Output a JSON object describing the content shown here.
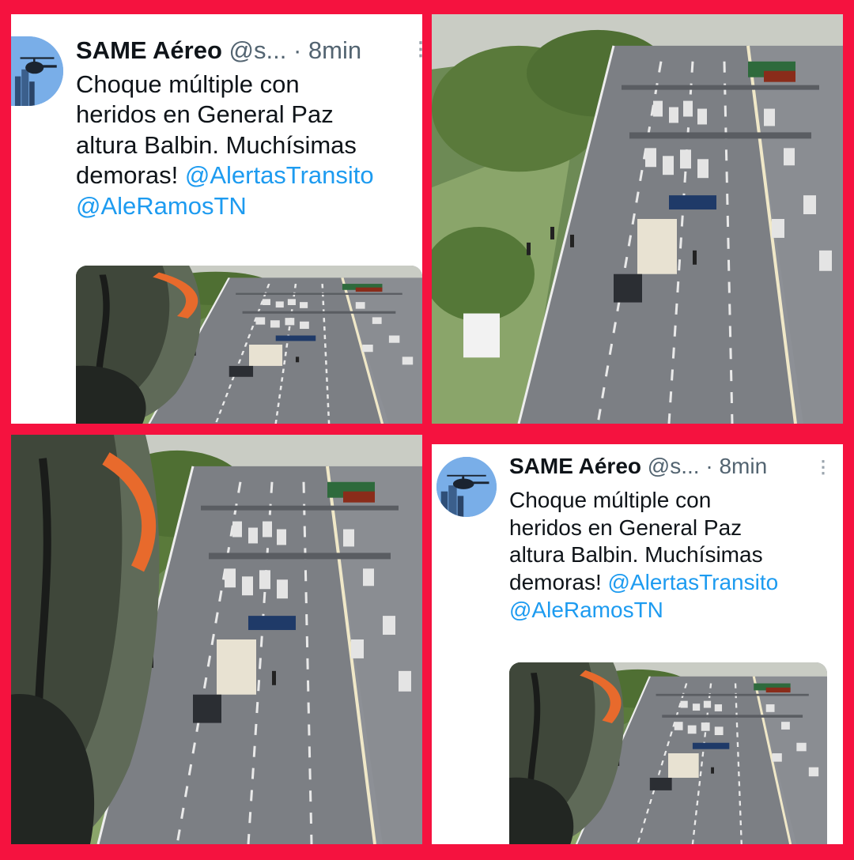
{
  "tweet": {
    "name": "SAME Aéreo",
    "handle": "@s...",
    "separator": "·",
    "time": "8min",
    "more_icon": "more-vertical-icon",
    "text_lines": [
      "Choque múltiple con",
      "heridos en General Paz",
      "altura Balbin. Muchísimas",
      "demoras!"
    ],
    "mention_1": "@AlertasTransito",
    "mention_2": "@AleRamosTN"
  },
  "colors": {
    "frame": "#f5123f",
    "mention": "#1d9bf0",
    "secondary_text": "#536471"
  }
}
